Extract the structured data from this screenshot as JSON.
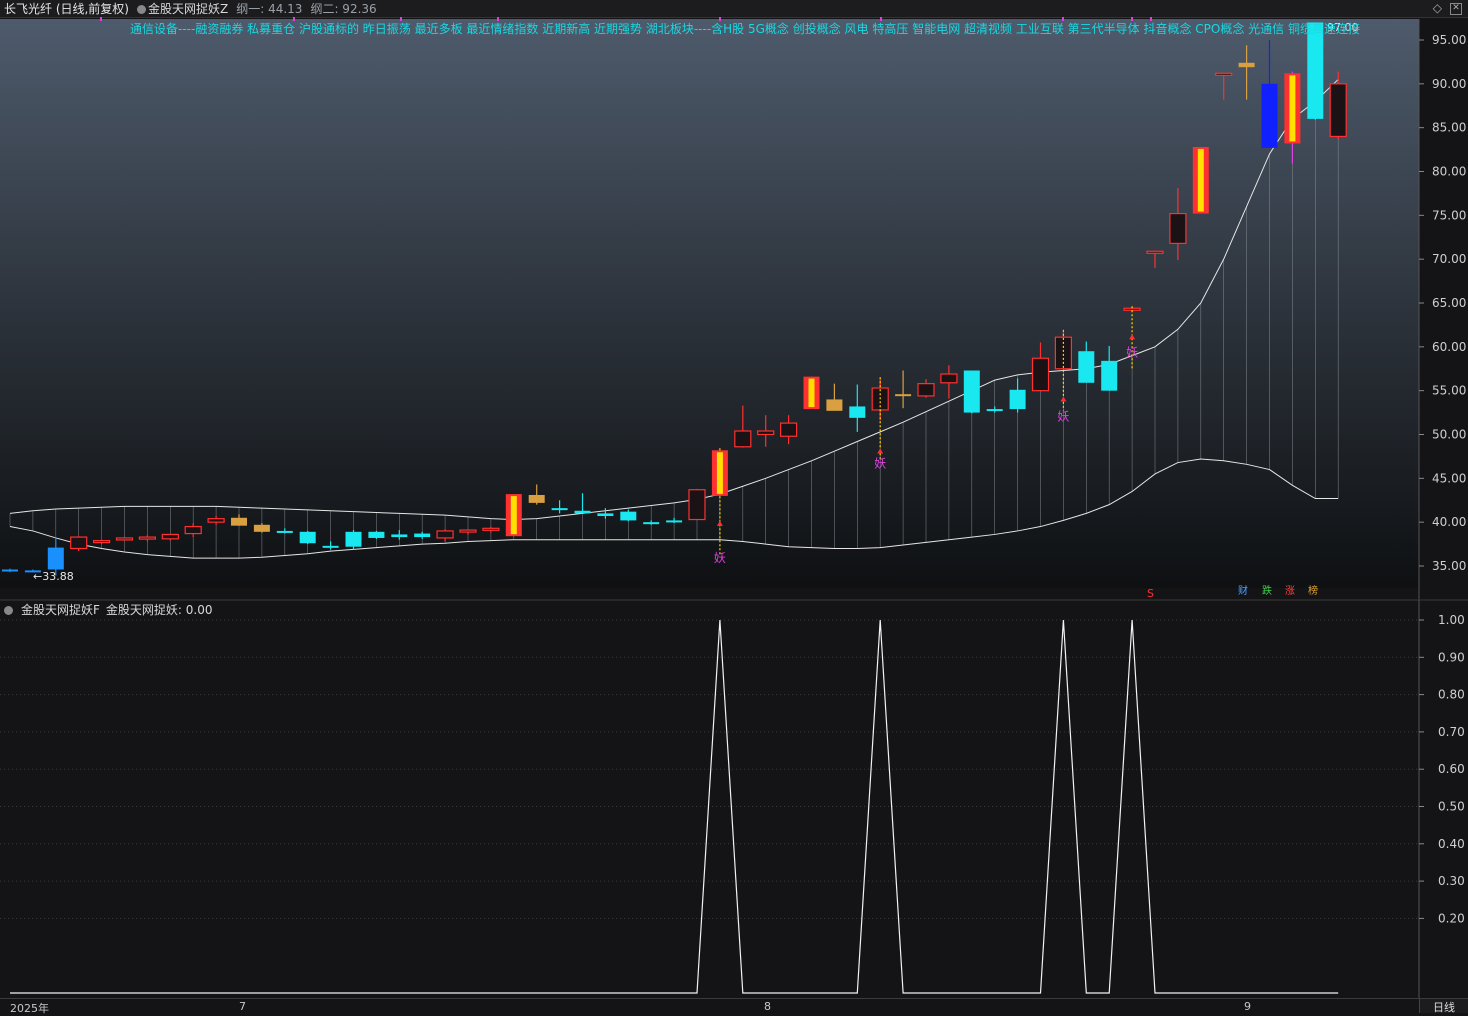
{
  "window": {
    "title": "长飞光纤 (日线,前复权)",
    "indicator_name": "金股天网捉妖Z",
    "line1_label": "纲一: 44.13",
    "line2_label": "纲二: 92.36"
  },
  "concepts_text": "通信设备----融资融券 私募重仓 沪股通标的 昨日振荡 最近多板 最近情绪指数 近期新高 近期强势 湖北板块----含H股 5G概念 创投概念 风电 特高压 智能电网 超清视频 工业互联 第三代半导体 抖音概念 CPO概念 光通信 铜缆高速连接",
  "sub_panel": {
    "indicator_name": "金股天网捉妖F",
    "value_label": "金股天网捉妖: 0.00"
  },
  "annotations": {
    "low_label": "←33.88",
    "high_label": "97.00",
    "signal_label": "妖",
    "s_marker": "S"
  },
  "badges": [
    {
      "text": "财",
      "color": "#4aa0ff"
    },
    {
      "text": "跌",
      "color": "#3ad04a"
    },
    {
      "text": "涨",
      "color": "#ff4040"
    },
    {
      "text": "榜",
      "color": "#e0a030"
    }
  ],
  "x_labels": [
    "2025年",
    "7",
    "8",
    "9"
  ],
  "period_label": "日线",
  "colors": {
    "up": "#ff3030",
    "down": "#19e8f0",
    "flat_gold": "#d8a040",
    "limit_up_fill": "#ffe000",
    "blue": "#1020ff",
    "signal": "#e040e0",
    "band": "#e6e6e6"
  },
  "chart_data": [
    {
      "type": "candlestick",
      "title": "",
      "y_axis_ticks": [
        35.0,
        40.0,
        45.0,
        50.0,
        55.0,
        60.0,
        65.0,
        70.0,
        75.0,
        80.0,
        85.0,
        90.0,
        95.0
      ],
      "ylim": [
        32.3,
        97.5
      ],
      "candles": [
        {
          "o": 34.6,
          "h": 34.7,
          "l": 34.3,
          "c": 34.4,
          "t": "blue"
        },
        {
          "o": 34.5,
          "h": 34.6,
          "l": 34.3,
          "c": 34.4,
          "t": "blue"
        },
        {
          "o": 37.1,
          "h": 38.3,
          "l": 33.9,
          "c": 34.6,
          "t": "blue"
        },
        {
          "o": 37.0,
          "h": 38.4,
          "l": 36.7,
          "c": 38.3,
          "t": "up"
        },
        {
          "o": 37.8,
          "h": 38.0,
          "l": 37.5,
          "c": 37.9,
          "t": "up"
        },
        {
          "o": 38.1,
          "h": 38.3,
          "l": 37.9,
          "c": 38.2,
          "t": "up"
        },
        {
          "o": 38.2,
          "h": 38.5,
          "l": 37.8,
          "c": 38.3,
          "t": "up"
        },
        {
          "o": 38.1,
          "h": 38.6,
          "l": 37.9,
          "c": 38.6,
          "t": "up"
        },
        {
          "o": 38.7,
          "h": 39.9,
          "l": 38.3,
          "c": 39.5,
          "t": "up"
        },
        {
          "o": 40.0,
          "h": 40.7,
          "l": 39.7,
          "c": 40.4,
          "t": "up"
        },
        {
          "o": 40.5,
          "h": 40.9,
          "l": 39.6,
          "c": 39.6,
          "t": "gold"
        },
        {
          "o": 39.7,
          "h": 39.9,
          "l": 38.8,
          "c": 38.9,
          "t": "gold"
        },
        {
          "o": 39.0,
          "h": 39.3,
          "l": 38.7,
          "c": 38.9,
          "t": "down"
        },
        {
          "o": 38.9,
          "h": 39.0,
          "l": 37.5,
          "c": 37.6,
          "t": "down"
        },
        {
          "o": 37.3,
          "h": 37.8,
          "l": 36.9,
          "c": 37.1,
          "t": "down"
        },
        {
          "o": 37.2,
          "h": 39.1,
          "l": 36.9,
          "c": 38.9,
          "t": "down"
        },
        {
          "o": 38.9,
          "h": 39.0,
          "l": 38.1,
          "c": 38.2,
          "t": "down"
        },
        {
          "o": 38.3,
          "h": 39.1,
          "l": 38.0,
          "c": 38.6,
          "t": "down"
        },
        {
          "o": 38.7,
          "h": 38.9,
          "l": 38.1,
          "c": 38.3,
          "t": "down"
        },
        {
          "o": 38.2,
          "h": 39.2,
          "l": 37.8,
          "c": 39.0,
          "t": "up"
        },
        {
          "o": 38.9,
          "h": 39.2,
          "l": 38.6,
          "c": 39.1,
          "t": "up"
        },
        {
          "o": 39.1,
          "h": 39.5,
          "l": 38.8,
          "c": 39.3,
          "t": "up"
        },
        {
          "o": 38.4,
          "h": 43.2,
          "l": 38.4,
          "c": 43.2,
          "t": "limit"
        },
        {
          "o": 43.1,
          "h": 44.3,
          "l": 42.0,
          "c": 42.2,
          "t": "gold"
        },
        {
          "o": 41.6,
          "h": 42.5,
          "l": 41.0,
          "c": 41.4,
          "t": "down"
        },
        {
          "o": 41.3,
          "h": 43.3,
          "l": 41.1,
          "c": 41.0,
          "t": "down"
        },
        {
          "o": 41.0,
          "h": 41.6,
          "l": 40.4,
          "c": 40.7,
          "t": "down"
        },
        {
          "o": 41.2,
          "h": 41.4,
          "l": 40.1,
          "c": 40.2,
          "t": "down"
        },
        {
          "o": 40.0,
          "h": 40.2,
          "l": 39.7,
          "c": 39.9,
          "t": "down"
        },
        {
          "o": 40.2,
          "h": 40.5,
          "l": 39.9,
          "c": 40.1,
          "t": "down"
        },
        {
          "o": 40.3,
          "h": 43.8,
          "l": 40.3,
          "c": 43.7,
          "t": "up"
        },
        {
          "o": 43.0,
          "h": 48.2,
          "l": 43.0,
          "c": 48.2,
          "t": "limit"
        },
        {
          "o": 48.6,
          "h": 53.3,
          "l": 48.5,
          "c": 50.4,
          "t": "up"
        },
        {
          "o": 50.0,
          "h": 52.2,
          "l": 48.6,
          "c": 50.4,
          "t": "up"
        },
        {
          "o": 49.8,
          "h": 52.2,
          "l": 48.9,
          "c": 51.3,
          "t": "up"
        },
        {
          "o": 52.9,
          "h": 56.6,
          "l": 52.9,
          "c": 56.6,
          "t": "limit"
        },
        {
          "o": 54.0,
          "h": 55.8,
          "l": 52.8,
          "c": 52.7,
          "t": "gold"
        },
        {
          "o": 53.2,
          "h": 55.7,
          "l": 50.3,
          "c": 51.9,
          "t": "down"
        },
        {
          "o": 52.8,
          "h": 56.3,
          "l": 51.6,
          "c": 55.3,
          "t": "up"
        },
        {
          "o": 54.6,
          "h": 57.3,
          "l": 53.0,
          "c": 54.5,
          "t": "gold"
        },
        {
          "o": 54.4,
          "h": 56.3,
          "l": 54.2,
          "c": 55.8,
          "t": "up"
        },
        {
          "o": 55.9,
          "h": 57.9,
          "l": 54.1,
          "c": 56.9,
          "t": "up"
        },
        {
          "o": 57.3,
          "h": 57.3,
          "l": 52.4,
          "c": 52.5,
          "t": "down"
        },
        {
          "o": 52.8,
          "h": 53.2,
          "l": 52.5,
          "c": 52.9,
          "t": "down"
        },
        {
          "o": 52.9,
          "h": 56.4,
          "l": 52.5,
          "c": 55.1,
          "t": "down"
        },
        {
          "o": 55.0,
          "h": 60.5,
          "l": 54.9,
          "c": 58.7,
          "t": "up"
        },
        {
          "o": 57.5,
          "h": 61.7,
          "l": 57.3,
          "c": 61.1,
          "t": "up"
        },
        {
          "o": 59.5,
          "h": 60.6,
          "l": 56.0,
          "c": 55.9,
          "t": "down"
        },
        {
          "o": 58.4,
          "h": 60.1,
          "l": 55.0,
          "c": 55.0,
          "t": "down"
        },
        {
          "o": 64.4,
          "h": 64.4,
          "l": 64.4,
          "c": 64.4,
          "t": "up"
        },
        {
          "o": 70.9,
          "h": 70.9,
          "l": 69.0,
          "c": 70.9,
          "t": "up"
        },
        {
          "o": 71.8,
          "h": 78.1,
          "l": 69.9,
          "c": 75.2,
          "t": "up"
        },
        {
          "o": 75.2,
          "h": 82.8,
          "l": 75.2,
          "c": 82.8,
          "t": "limit"
        },
        {
          "o": 91.2,
          "h": 91.2,
          "l": 88.2,
          "c": 91.2,
          "t": "up"
        },
        {
          "o": 92.4,
          "h": 94.4,
          "l": 88.2,
          "c": 91.9,
          "t": "gold"
        },
        {
          "o": 90.0,
          "h": 95.0,
          "l": 82.7,
          "c": 82.7,
          "t": "blue"
        },
        {
          "o": 83.2,
          "h": 91.4,
          "l": 80.9,
          "c": 91.2,
          "t": "limit"
        },
        {
          "o": 97.0,
          "h": 97.0,
          "l": 85.9,
          "c": 86.0,
          "t": "down"
        },
        {
          "o": 90.0,
          "h": 91.4,
          "l": 83.7,
          "c": 84.0,
          "t": "up"
        }
      ],
      "upper_band": [
        41.0,
        41.3,
        41.5,
        41.6,
        41.7,
        41.8,
        41.8,
        41.8,
        41.8,
        41.8,
        41.7,
        41.6,
        41.5,
        41.4,
        41.3,
        41.2,
        41.1,
        41.0,
        40.9,
        40.8,
        40.6,
        40.4,
        40.3,
        40.4,
        40.7,
        41.0,
        41.3,
        41.6,
        41.9,
        42.2,
        42.6,
        43.2,
        44.1,
        45.0,
        46.0,
        47.0,
        48.1,
        49.2,
        50.3,
        51.4,
        52.6,
        53.8,
        55.0,
        56.2,
        56.8,
        57.1,
        57.3,
        57.5,
        58.0,
        59.0,
        60.0,
        62.0,
        65.0,
        70.0,
        76.0,
        82.0,
        86.0,
        88.0,
        90.5
      ],
      "lower_band": [
        39.5,
        39.0,
        38.2,
        37.5,
        37.0,
        36.6,
        36.3,
        36.1,
        35.9,
        35.9,
        35.9,
        36.0,
        36.2,
        36.4,
        36.7,
        36.9,
        37.1,
        37.3,
        37.5,
        37.6,
        37.8,
        37.9,
        38.0,
        38.0,
        38.0,
        38.0,
        38.0,
        38.0,
        38.0,
        38.0,
        38.0,
        38.0,
        37.8,
        37.5,
        37.2,
        37.1,
        37.0,
        37.0,
        37.1,
        37.4,
        37.7,
        38.0,
        38.3,
        38.6,
        39.0,
        39.5,
        40.2,
        41.0,
        42.0,
        43.5,
        45.5,
        46.8,
        47.2,
        47.0,
        46.6,
        46.0,
        44.2,
        42.7,
        42.7
      ]
    },
    {
      "type": "line",
      "title": "",
      "y_axis_ticks": [
        0.2,
        0.3,
        0.4,
        0.5,
        0.6,
        0.7,
        0.8,
        0.9,
        1.0
      ],
      "ylim": [
        0,
        1.0
      ],
      "values": [
        0,
        0,
        0,
        0,
        0,
        0,
        0,
        0,
        0,
        0,
        0,
        0,
        0,
        0,
        0,
        0,
        0,
        0,
        0,
        0,
        0,
        0,
        0,
        0,
        0,
        0,
        0,
        0,
        0,
        0,
        0,
        1,
        0,
        0,
        0,
        0,
        0,
        0,
        1,
        0,
        0,
        0,
        0,
        0,
        0,
        0,
        1,
        0,
        0,
        1,
        0,
        0,
        0,
        0,
        0,
        0,
        0,
        0,
        0
      ]
    }
  ]
}
